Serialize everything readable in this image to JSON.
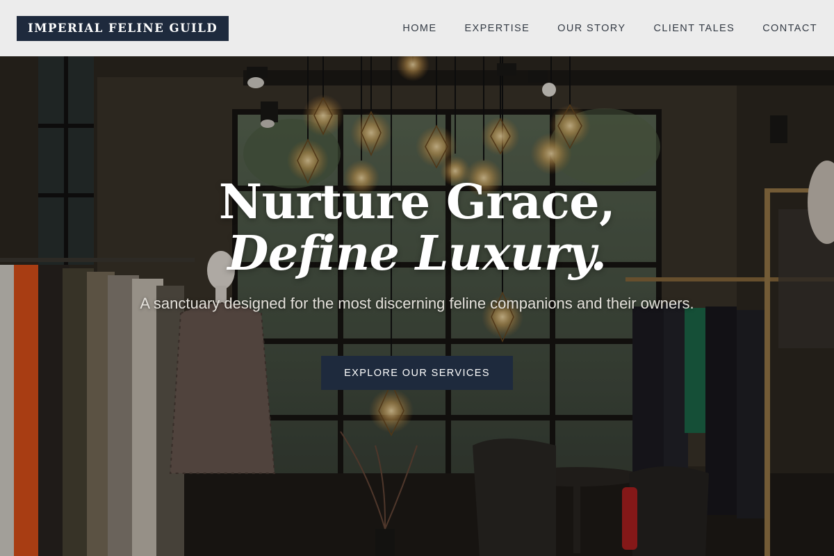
{
  "header": {
    "logo": "IMPERIAL FELINE GUILD",
    "nav": [
      {
        "label": "HOME"
      },
      {
        "label": "EXPERTISE"
      },
      {
        "label": "OUR STORY"
      },
      {
        "label": "CLIENT TALES"
      },
      {
        "label": "CONTACT"
      }
    ]
  },
  "hero": {
    "title_line_1": "Nurture Grace,",
    "title_line_2": "Define Luxury.",
    "subtitle": "A sanctuary designed for the most discerning feline companions and their owners.",
    "cta_label": "EXPLORE OUR SERVICES"
  },
  "colors": {
    "brand_navy": "#1e2a3d",
    "header_bg": "#ececec",
    "nav_text": "#333a44"
  }
}
